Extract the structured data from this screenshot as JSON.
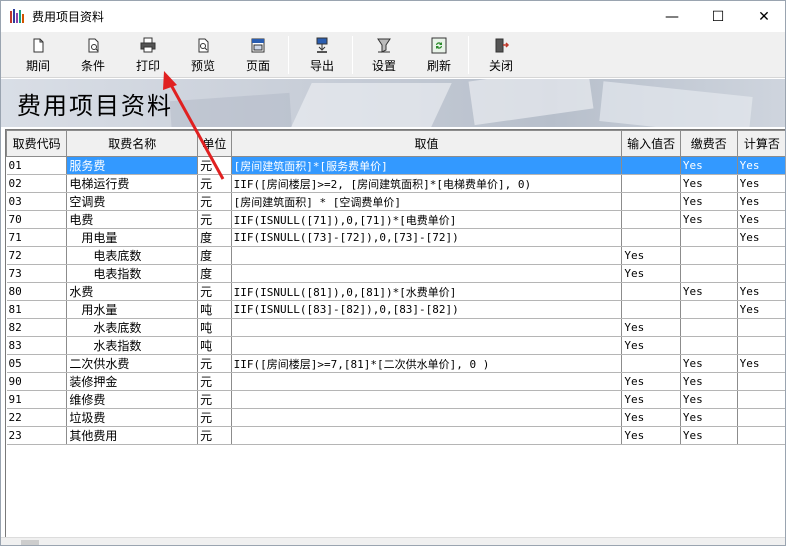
{
  "window": {
    "title": "费用项目资料",
    "minimize_glyph": "—",
    "maximize_glyph": "☐",
    "close_glyph": "✕"
  },
  "toolbar": {
    "buttons": [
      {
        "label": "期间",
        "icon": "calendar-page-icon"
      },
      {
        "label": "条件",
        "icon": "filter-document-icon"
      },
      {
        "label": "打印",
        "icon": "printer-icon"
      },
      {
        "label": "预览",
        "icon": "print-preview-icon"
      },
      {
        "label": "页面",
        "icon": "page-setup-icon"
      },
      {
        "label": "导出",
        "icon": "export-icon"
      },
      {
        "label": "设置",
        "icon": "settings-funnel-icon"
      },
      {
        "label": "刷新",
        "icon": "refresh-icon"
      },
      {
        "label": "关闭",
        "icon": "exit-door-icon"
      }
    ]
  },
  "banner": {
    "title": "费用项目资料"
  },
  "table": {
    "headers": [
      "取费代码",
      "取费名称",
      "单位",
      "取值",
      "输入值否",
      "缴费否",
      "计算否"
    ],
    "rows": [
      {
        "code": "01",
        "name": "服务费",
        "indent": 0,
        "unit": "元",
        "value": "[房间建筑面积]*[服务费单价]",
        "input": "",
        "pay": "Yes",
        "calc": "Yes",
        "selected": true
      },
      {
        "code": "02",
        "name": "电梯运行费",
        "indent": 0,
        "unit": "元",
        "value": "IIF([房间楼层]>=2, [房间建筑面积]*[电梯费单价], 0)",
        "input": "",
        "pay": "Yes",
        "calc": "Yes"
      },
      {
        "code": "03",
        "name": "空调费",
        "indent": 0,
        "unit": "元",
        "value": "[房间建筑面积] * [空调费单价]",
        "input": "",
        "pay": "Yes",
        "calc": "Yes"
      },
      {
        "code": "70",
        "name": "电费",
        "indent": 0,
        "unit": "元",
        "value": "IIF(ISNULL([71]),0,[71])*[电费单价]",
        "input": "",
        "pay": "Yes",
        "calc": "Yes"
      },
      {
        "code": "71",
        "name": "用电量",
        "indent": 1,
        "unit": "度",
        "value": "IIF(ISNULL([73]-[72]),0,[73]-[72])",
        "input": "",
        "pay": "",
        "calc": "Yes"
      },
      {
        "code": "72",
        "name": "电表底数",
        "indent": 2,
        "unit": "度",
        "value": "",
        "input": "Yes",
        "pay": "",
        "calc": ""
      },
      {
        "code": "73",
        "name": "电表指数",
        "indent": 2,
        "unit": "度",
        "value": "",
        "input": "Yes",
        "pay": "",
        "calc": ""
      },
      {
        "code": "80",
        "name": "水费",
        "indent": 0,
        "unit": "元",
        "value": "IIF(ISNULL([81]),0,[81])*[水费单价]",
        "input": "",
        "pay": "Yes",
        "calc": "Yes"
      },
      {
        "code": "81",
        "name": "用水量",
        "indent": 1,
        "unit": "吨",
        "value": "IIF(ISNULL([83]-[82]),0,[83]-[82])",
        "input": "",
        "pay": "",
        "calc": "Yes"
      },
      {
        "code": "82",
        "name": "水表底数",
        "indent": 2,
        "unit": "吨",
        "value": "",
        "input": "Yes",
        "pay": "",
        "calc": ""
      },
      {
        "code": "83",
        "name": "水表指数",
        "indent": 2,
        "unit": "吨",
        "value": "",
        "input": "Yes",
        "pay": "",
        "calc": ""
      },
      {
        "code": "05",
        "name": "二次供水费",
        "indent": 0,
        "unit": "元",
        "value": "IIF([房间楼层]>=7,[81]*[二次供水单价], 0 )",
        "input": "",
        "pay": "Yes",
        "calc": "Yes"
      },
      {
        "code": "90",
        "name": "装修押金",
        "indent": 0,
        "unit": "元",
        "value": "",
        "input": "Yes",
        "pay": "Yes",
        "calc": ""
      },
      {
        "code": "91",
        "name": "维修费",
        "indent": 0,
        "unit": "元",
        "value": "",
        "input": "Yes",
        "pay": "Yes",
        "calc": ""
      },
      {
        "code": "22",
        "name": "垃圾费",
        "indent": 0,
        "unit": "元",
        "value": "",
        "input": "Yes",
        "pay": "Yes",
        "calc": ""
      },
      {
        "code": "23",
        "name": "其他费用",
        "indent": 0,
        "unit": "元",
        "value": "",
        "input": "Yes",
        "pay": "Yes",
        "calc": ""
      }
    ]
  },
  "colors": {
    "selection": "#3399ff",
    "annotation_arrow": "#e02020"
  }
}
